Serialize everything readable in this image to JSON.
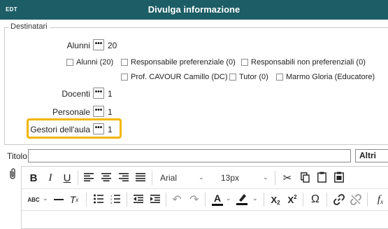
{
  "window": {
    "edt_label": "EDT",
    "title": "Divulga informazione"
  },
  "recipients": {
    "legend": "Destinatari",
    "rows": [
      {
        "label": "Alunni",
        "count": "20"
      },
      {
        "label": "Docenti",
        "count": "1"
      },
      {
        "label": "Personale",
        "count": "1"
      },
      {
        "label": "Gestori dell'aula",
        "count": "1"
      }
    ],
    "dots_label": "•••",
    "checkboxes": [
      {
        "label": "Alunni (20)",
        "checked": false
      },
      {
        "label": "Responsabile preferenziale (0)",
        "checked": false
      },
      {
        "label": "Responsabili non preferenziali (0)",
        "checked": false
      },
      {
        "label": "Prof. CAVOUR Camillo (DC)",
        "checked": false
      },
      {
        "label": "Tutor (0)",
        "checked": false
      },
      {
        "label": "Marmo Gloria (Educatore)",
        "checked": false
      }
    ]
  },
  "titolo": {
    "label": "Titolo",
    "value": "",
    "placeholder": ""
  },
  "altri": {
    "selected": "Altri"
  },
  "editor": {
    "font_family": "Arial",
    "font_size": "13px",
    "toolbar_row1": [
      "bold",
      "italic",
      "underline",
      "align-left",
      "align-center",
      "align-right",
      "align-justify",
      "font-family",
      "font-size",
      "cut",
      "copy",
      "paste",
      "paste-text"
    ],
    "toolbar_row2": [
      "spellcheck",
      "horizontal-line",
      "clear-formatting",
      "bullet-list",
      "numbered-list",
      "outdent",
      "indent",
      "undo",
      "redo",
      "text-color",
      "highlight-color",
      "subscript",
      "superscript",
      "special-character",
      "link",
      "unlink",
      "formula"
    ]
  },
  "colors": {
    "title_bar": "#1c5d66",
    "highlight": "#f2b600"
  }
}
